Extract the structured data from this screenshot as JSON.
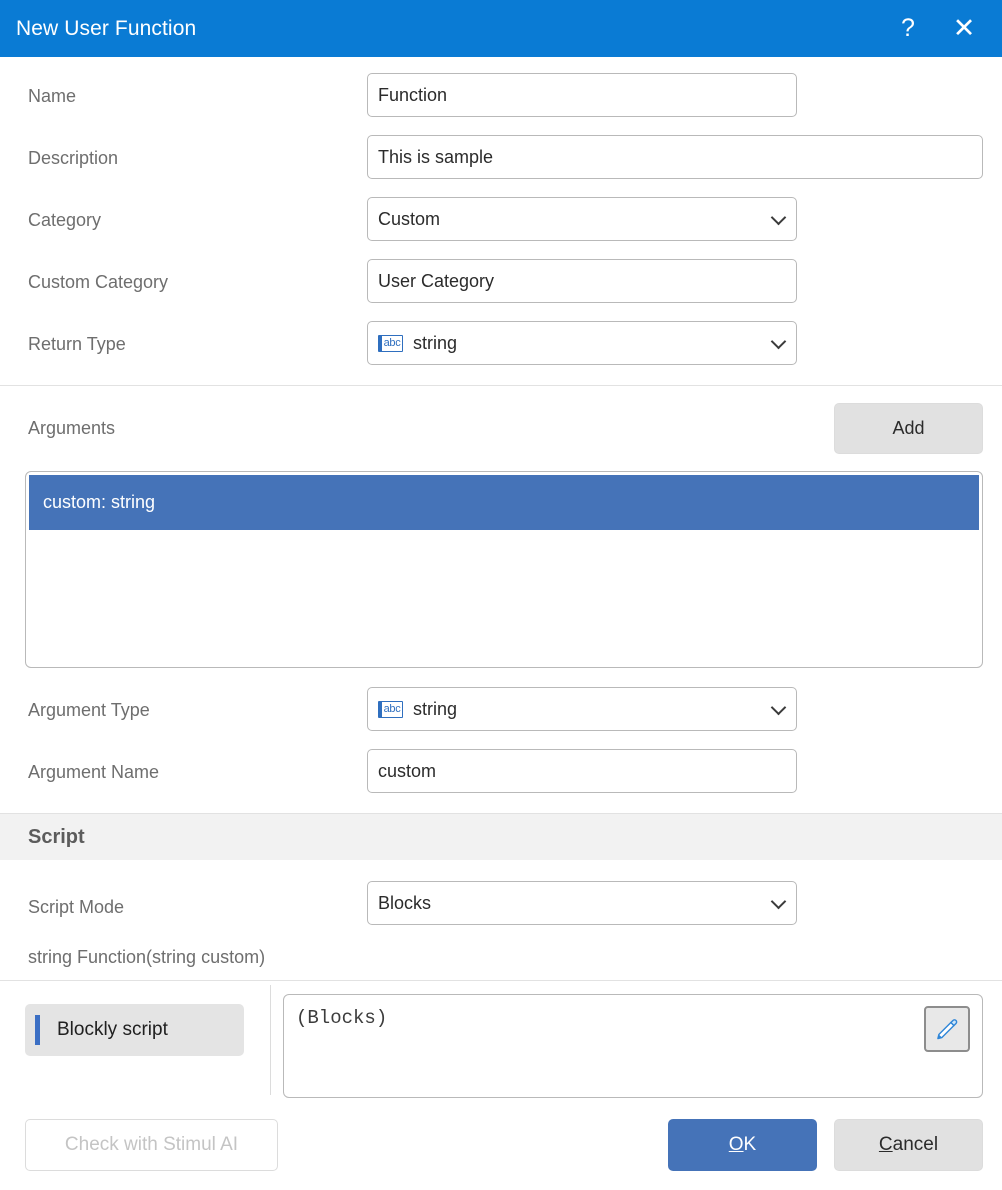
{
  "window": {
    "title": "New User Function",
    "help_icon": "question-mark-icon",
    "close_icon": "close-icon",
    "titlebar_color": "#0a7bd4"
  },
  "form": {
    "name": {
      "label": "Name",
      "value": "Function",
      "placeholder": ""
    },
    "description": {
      "label": "Description",
      "value": "This is sample",
      "placeholder": ""
    },
    "category": {
      "label": "Category",
      "value": "Custom",
      "chevron_icon": "chevron-down-icon"
    },
    "custom_category": {
      "label": "Custom Category",
      "value": "User Category",
      "placeholder": ""
    },
    "return_type": {
      "label": "Return Type",
      "value": "string",
      "type_icon": "abc-string-type-icon",
      "type_icon_text": "abc",
      "chevron_icon": "chevron-down-icon"
    }
  },
  "arguments": {
    "label": "Arguments",
    "add_button": "Add",
    "items": [
      {
        "text": "custom: string",
        "selected": true
      }
    ],
    "selected_color": "#4573b8",
    "argument_type": {
      "label": "Argument Type",
      "value": "string",
      "type_icon": "abc-string-type-icon",
      "type_icon_text": "abc",
      "chevron_icon": "chevron-down-icon"
    },
    "argument_name": {
      "label": "Argument Name",
      "value": "custom",
      "placeholder": ""
    }
  },
  "script": {
    "section_title": "Script",
    "mode": {
      "label": "Script Mode",
      "value": "Blocks",
      "chevron_icon": "chevron-down-icon"
    },
    "signature": "string Function(string custom)",
    "tab": {
      "label": "Blockly script",
      "accent_color": "#3b6fc4"
    },
    "editor": {
      "content": "(Blocks)",
      "edit_icon": "pencil-edit-icon"
    }
  },
  "footer": {
    "check_ai": {
      "label": "Check with Stimul AI",
      "enabled": false
    },
    "ok": {
      "label_before": "",
      "accel": "O",
      "label_after": "K"
    },
    "cancel": {
      "label_before": "",
      "accel": "C",
      "label_after": "ancel"
    }
  }
}
